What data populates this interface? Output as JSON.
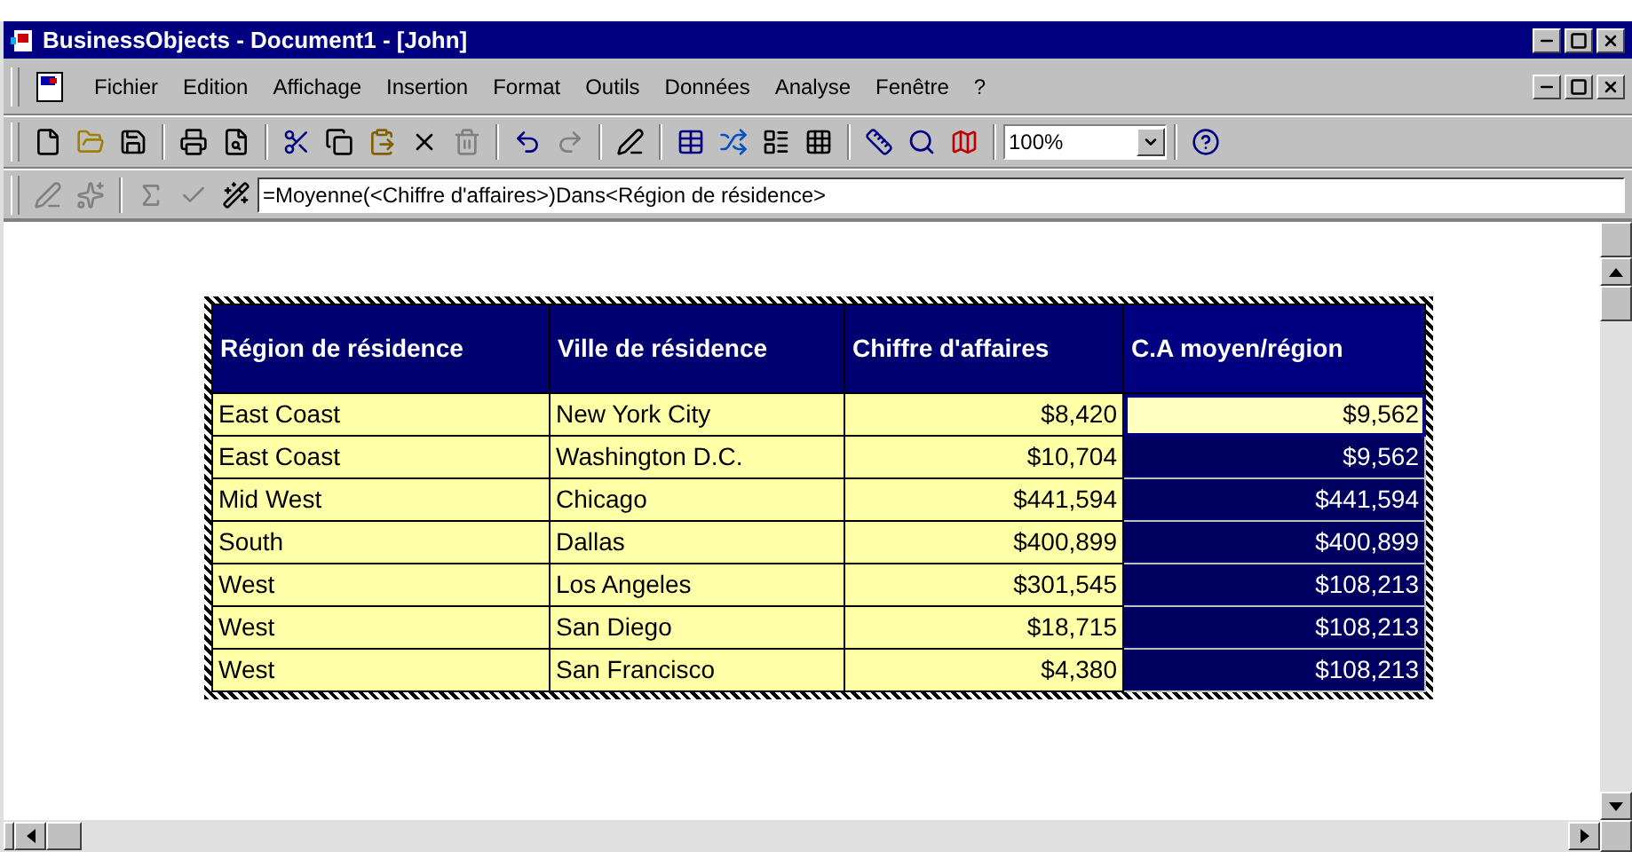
{
  "window": {
    "title": "BusinessObjects - Document1 - [John]"
  },
  "menu": [
    "Fichier",
    "Edition",
    "Affichage",
    "Insertion",
    "Format",
    "Outils",
    "Données",
    "Analyse",
    "Fenêtre",
    "?"
  ],
  "zoom": {
    "value": "100%"
  },
  "formula": {
    "value": "=Moyenne(<Chiffre d'affaires>)Dans<Région de résidence>"
  },
  "table": {
    "columns": [
      {
        "label": "Région de résidence",
        "selected": false,
        "kind": "text"
      },
      {
        "label": "Ville de résidence",
        "selected": false,
        "kind": "text"
      },
      {
        "label": "Chiffre d'affaires",
        "selected": false,
        "kind": "amount"
      },
      {
        "label": "C.A moyen/région",
        "selected": true,
        "kind": "amount"
      }
    ],
    "rows": [
      {
        "cells": [
          "East Coast",
          "New York City",
          "$8,420",
          "$9,562"
        ],
        "focused": true
      },
      {
        "cells": [
          "East Coast",
          "Washington D.C.",
          "$10,704",
          "$9,562"
        ],
        "focused": false
      },
      {
        "cells": [
          "Mid West",
          "Chicago",
          "$441,594",
          "$441,594"
        ],
        "focused": false
      },
      {
        "cells": [
          "South",
          "Dallas",
          "$400,899",
          "$400,899"
        ],
        "focused": false
      },
      {
        "cells": [
          "West",
          "Los Angeles",
          "$301,545",
          "$108,213"
        ],
        "focused": false
      },
      {
        "cells": [
          "West",
          "San Diego",
          "$18,715",
          "$108,213"
        ],
        "focused": false
      },
      {
        "cells": [
          "West",
          "San Francisco",
          "$4,380",
          "$108,213"
        ],
        "focused": false
      }
    ]
  }
}
